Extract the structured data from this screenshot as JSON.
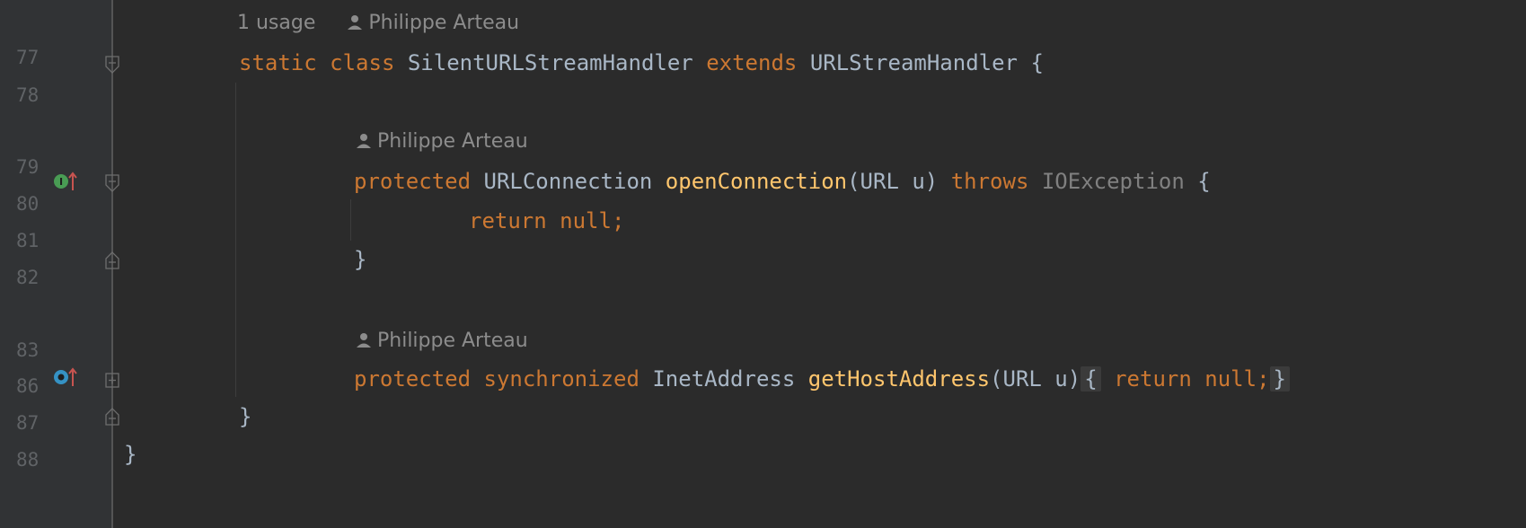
{
  "gutter": {
    "line_numbers": [
      "77",
      "78",
      "79",
      "80",
      "81",
      "82",
      "83",
      "86",
      "87",
      "88"
    ]
  },
  "hints": {
    "usage": "1 usage",
    "author": "Philippe Arteau"
  },
  "code": {
    "l77": {
      "k1": "static",
      "k2": "class",
      "name": "SilentURLStreamHandler",
      "k3": "extends",
      "parent": "URLStreamHandler",
      "brace": "{"
    },
    "l79": {
      "k1": "protected",
      "type": "URLConnection",
      "fn": "openConnection",
      "params": "(URL u)",
      "k2": "throws",
      "exc": "IOException",
      "brace": "{"
    },
    "l80": {
      "k1": "return",
      "v": "null",
      "semi": ";"
    },
    "l81": {
      "brace": "}"
    },
    "l83": {
      "k1": "protected",
      "k2": "synchronized",
      "type": "InetAddress",
      "fn": "getHostAddress",
      "params": "(URL u)",
      "open": "{",
      "ret": "return",
      "v": "null;",
      "close": "}"
    },
    "l86": {
      "brace": "}"
    },
    "l87": {
      "brace": "}"
    }
  },
  "icons": {
    "implements": "implements-method-icon",
    "overrides": "overrides-method-icon",
    "colors": {
      "green": "#499c54",
      "blue": "#3592c4",
      "red": "#c75450"
    }
  }
}
